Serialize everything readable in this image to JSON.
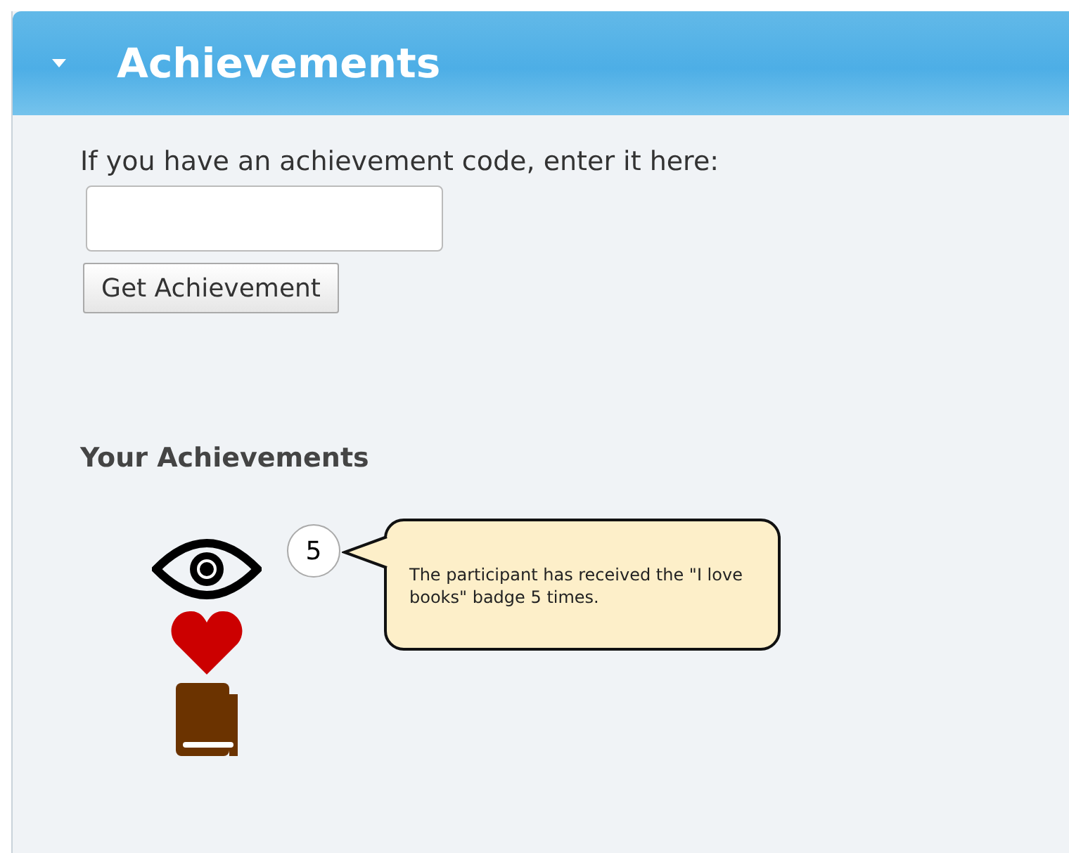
{
  "panel": {
    "title": "Achievements",
    "expanded": true
  },
  "code_form": {
    "prompt": "If you have an achievement code, enter it here:",
    "button": "Get Achievement"
  },
  "achievements": {
    "heading": "Your Achievements",
    "badges": [
      {
        "kind": "eye"
      },
      {
        "kind": "heart"
      },
      {
        "kind": "book"
      }
    ],
    "count": "5",
    "tooltip": "The participant has received the \"I love books\" badge 5 times."
  }
}
